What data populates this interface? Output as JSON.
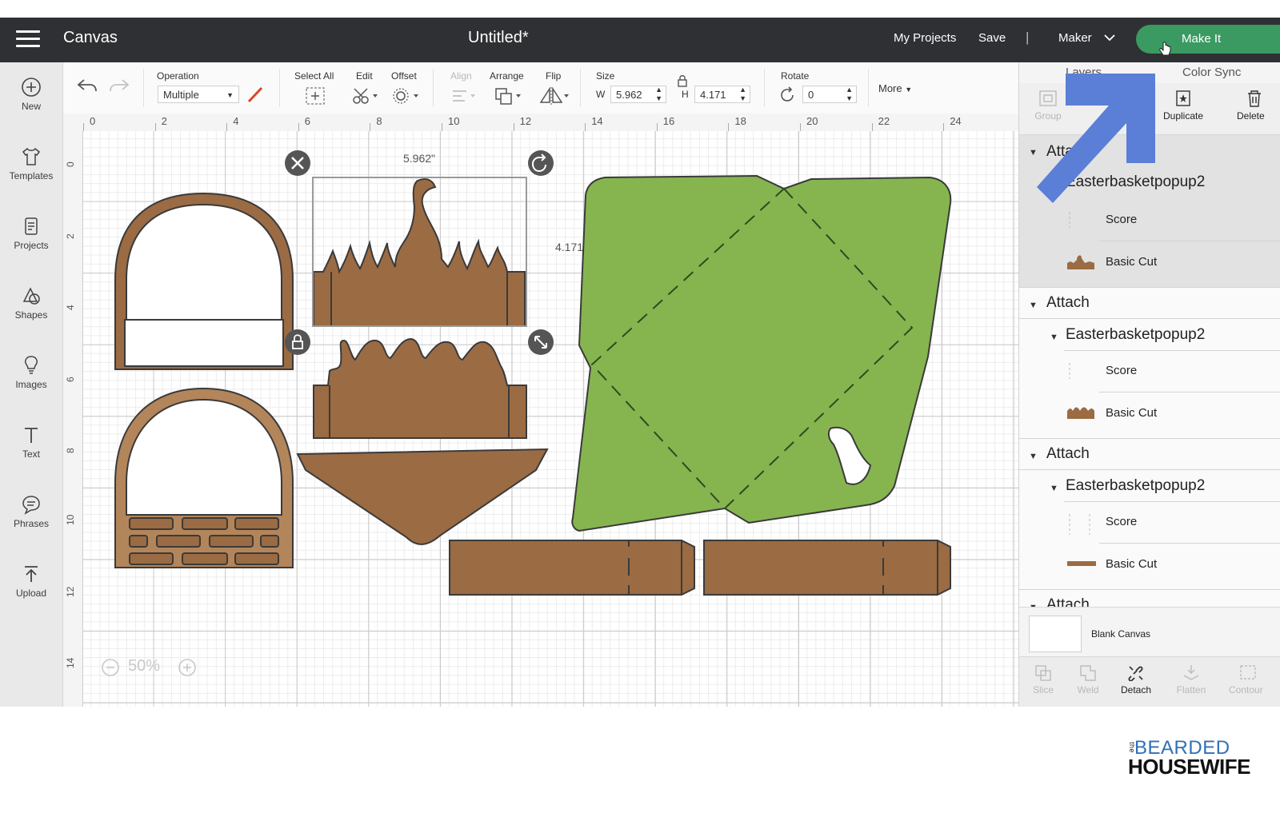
{
  "header": {
    "app_title": "Canvas",
    "doc_title": "Untitled*",
    "my_projects": "My Projects",
    "save": "Save",
    "separator": "|",
    "machine": "Maker",
    "make_it": "Make It"
  },
  "sidebar": {
    "items": [
      {
        "label": "New",
        "icon": "plus-circle-icon"
      },
      {
        "label": "Templates",
        "icon": "shirt-icon"
      },
      {
        "label": "Projects",
        "icon": "projects-icon"
      },
      {
        "label": "Shapes",
        "icon": "shapes-icon"
      },
      {
        "label": "Images",
        "icon": "lightbulb-icon"
      },
      {
        "label": "Text",
        "icon": "text-icon"
      },
      {
        "label": "Phrases",
        "icon": "speech-bubble-icon"
      },
      {
        "label": "Upload",
        "icon": "upload-icon"
      }
    ]
  },
  "toolbar": {
    "operation_label": "Operation",
    "operation_value": "Multiple",
    "select_all": "Select All",
    "edit": "Edit",
    "offset": "Offset",
    "align": "Align",
    "arrange": "Arrange",
    "flip": "Flip",
    "size": "Size",
    "w_label": "W",
    "w_value": "5.962",
    "h_label": "H",
    "h_value": "4.171",
    "rotate": "Rotate",
    "rotate_value": "0",
    "more": "More"
  },
  "ruler": {
    "h_ticks": [
      "0",
      "2",
      "4",
      "6",
      "8",
      "10",
      "12",
      "14",
      "16",
      "18",
      "20",
      "22",
      "24"
    ],
    "v_ticks": [
      "0",
      "2",
      "4",
      "6",
      "8",
      "10",
      "12",
      "14"
    ]
  },
  "canvas": {
    "width_readout": "5.962\"",
    "height_readout": "4.171\"",
    "zoom": "50%",
    "colors": {
      "brown": "#9b6b43",
      "light_brown": "#b3855a",
      "green": "#86b550",
      "outline": "#3a3a3a"
    }
  },
  "panel": {
    "tabs": [
      "Layers",
      "Color Sync"
    ],
    "tools": [
      "Group",
      "Duplicate",
      "Delete"
    ],
    "layers": {
      "group1": {
        "title": "Attach",
        "child": "Easterbasketpopup2",
        "score": "Score",
        "cut": "Basic Cut"
      },
      "group2": {
        "title": "Attach",
        "child": "Easterbasketpopup2",
        "score": "Score",
        "cut": "Basic Cut"
      },
      "group3": {
        "title": "Attach",
        "child": "Easterbasketpopup2",
        "score": "Score",
        "cut": "Basic Cut"
      },
      "group4": {
        "title": "Attach"
      }
    },
    "blank_canvas": "Blank Canvas",
    "bottom_tools": [
      "Slice",
      "Weld",
      "Detach",
      "Flatten",
      "Contour"
    ]
  },
  "overlay": {
    "arrow_color": "#5b7fd6"
  },
  "branding": {
    "line1_small": "the",
    "line1": "BEARDED",
    "line2": "HOUSEWIFE"
  }
}
